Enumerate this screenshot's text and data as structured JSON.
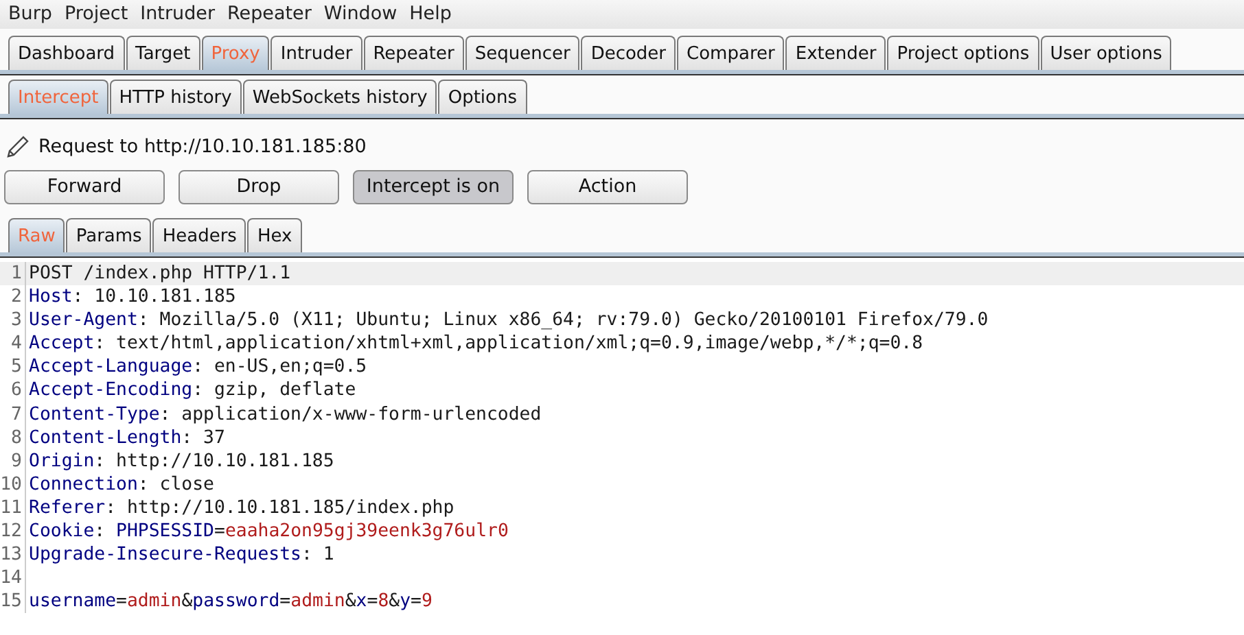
{
  "menu": [
    "Burp",
    "Project",
    "Intruder",
    "Repeater",
    "Window",
    "Help"
  ],
  "main_tabs": [
    {
      "label": "Dashboard",
      "selected": false
    },
    {
      "label": "Target",
      "selected": false
    },
    {
      "label": "Proxy",
      "selected": true
    },
    {
      "label": "Intruder",
      "selected": false
    },
    {
      "label": "Repeater",
      "selected": false
    },
    {
      "label": "Sequencer",
      "selected": false
    },
    {
      "label": "Decoder",
      "selected": false
    },
    {
      "label": "Comparer",
      "selected": false
    },
    {
      "label": "Extender",
      "selected": false
    },
    {
      "label": "Project options",
      "selected": false
    },
    {
      "label": "User options",
      "selected": false
    }
  ],
  "proxy_tabs": [
    {
      "label": "Intercept",
      "selected": true
    },
    {
      "label": "HTTP history",
      "selected": false
    },
    {
      "label": "WebSockets history",
      "selected": false
    },
    {
      "label": "Options",
      "selected": false
    }
  ],
  "request_label": "Request to http://10.10.181.185:80",
  "buttons": [
    {
      "label": "Forward",
      "pressed": false
    },
    {
      "label": "Drop",
      "pressed": false
    },
    {
      "label": "Intercept is on",
      "pressed": true
    },
    {
      "label": "Action",
      "pressed": false
    }
  ],
  "view_tabs": [
    {
      "label": "Raw",
      "selected": true
    },
    {
      "label": "Params",
      "selected": false
    },
    {
      "label": "Headers",
      "selected": false
    },
    {
      "label": "Hex",
      "selected": false
    }
  ],
  "lines": [
    {
      "number": "1",
      "highlighted": true,
      "segments": [
        {
          "kind": "plain",
          "text": "POST /index.php HTTP/1.1"
        }
      ]
    },
    {
      "number": "2",
      "highlighted": false,
      "segments": [
        {
          "kind": "key",
          "text": "Host"
        },
        {
          "kind": "plain",
          "text": ": 10.10.181.185"
        }
      ]
    },
    {
      "number": "3",
      "highlighted": false,
      "segments": [
        {
          "kind": "key",
          "text": "User-Agent"
        },
        {
          "kind": "plain",
          "text": ": Mozilla/5.0 (X11; Ubuntu; Linux x86_64; rv:79.0) Gecko/20100101 Firefox/79.0"
        }
      ]
    },
    {
      "number": "4",
      "highlighted": false,
      "segments": [
        {
          "kind": "key",
          "text": "Accept"
        },
        {
          "kind": "plain",
          "text": ": text/html,application/xhtml+xml,application/xml;q=0.9,image/webp,*/*;q=0.8"
        }
      ]
    },
    {
      "number": "5",
      "highlighted": false,
      "segments": [
        {
          "kind": "key",
          "text": "Accept-Language"
        },
        {
          "kind": "plain",
          "text": ": en-US,en;q=0.5"
        }
      ]
    },
    {
      "number": "6",
      "highlighted": false,
      "segments": [
        {
          "kind": "key",
          "text": "Accept-Encoding"
        },
        {
          "kind": "plain",
          "text": ": gzip, deflate"
        }
      ]
    },
    {
      "number": "7",
      "highlighted": false,
      "segments": [
        {
          "kind": "key",
          "text": "Content-Type"
        },
        {
          "kind": "plain",
          "text": ": application/x-www-form-urlencoded"
        }
      ]
    },
    {
      "number": "8",
      "highlighted": false,
      "segments": [
        {
          "kind": "key",
          "text": "Content-Length"
        },
        {
          "kind": "plain",
          "text": ": 37"
        }
      ]
    },
    {
      "number": "9",
      "highlighted": false,
      "segments": [
        {
          "kind": "key",
          "text": "Origin"
        },
        {
          "kind": "plain",
          "text": ": http://10.10.181.185"
        }
      ]
    },
    {
      "number": "10",
      "highlighted": false,
      "segments": [
        {
          "kind": "key",
          "text": "Connection"
        },
        {
          "kind": "plain",
          "text": ": close"
        }
      ]
    },
    {
      "number": "11",
      "highlighted": false,
      "segments": [
        {
          "kind": "key",
          "text": "Referer"
        },
        {
          "kind": "plain",
          "text": ": http://10.10.181.185/index.php"
        }
      ]
    },
    {
      "number": "12",
      "highlighted": false,
      "segments": [
        {
          "kind": "key",
          "text": "Cookie"
        },
        {
          "kind": "plain",
          "text": ": "
        },
        {
          "kind": "key",
          "text": "PHPSESSID"
        },
        {
          "kind": "plain",
          "text": "="
        },
        {
          "kind": "value",
          "text": "eaaha2on95gj39eenk3g76ulr0"
        }
      ]
    },
    {
      "number": "13",
      "highlighted": false,
      "segments": [
        {
          "kind": "key",
          "text": "Upgrade-Insecure-Requests"
        },
        {
          "kind": "plain",
          "text": ": 1"
        }
      ]
    },
    {
      "number": "14",
      "highlighted": false
    },
    {
      "number": "15",
      "highlighted": false,
      "segments": [
        {
          "kind": "key",
          "text": "username"
        },
        {
          "kind": "plain",
          "text": "="
        },
        {
          "kind": "value",
          "text": "admin"
        },
        {
          "kind": "plain",
          "text": "&"
        },
        {
          "kind": "key",
          "text": "password"
        },
        {
          "kind": "plain",
          "text": "="
        },
        {
          "kind": "value",
          "text": "admin"
        },
        {
          "kind": "plain",
          "text": "&"
        },
        {
          "kind": "key",
          "text": "x"
        },
        {
          "kind": "plain",
          "text": "="
        },
        {
          "kind": "value",
          "text": "8"
        },
        {
          "kind": "plain",
          "text": "&"
        },
        {
          "kind": "key",
          "text": "y"
        },
        {
          "kind": "plain",
          "text": "="
        },
        {
          "kind": "value",
          "text": "9"
        }
      ]
    }
  ]
}
